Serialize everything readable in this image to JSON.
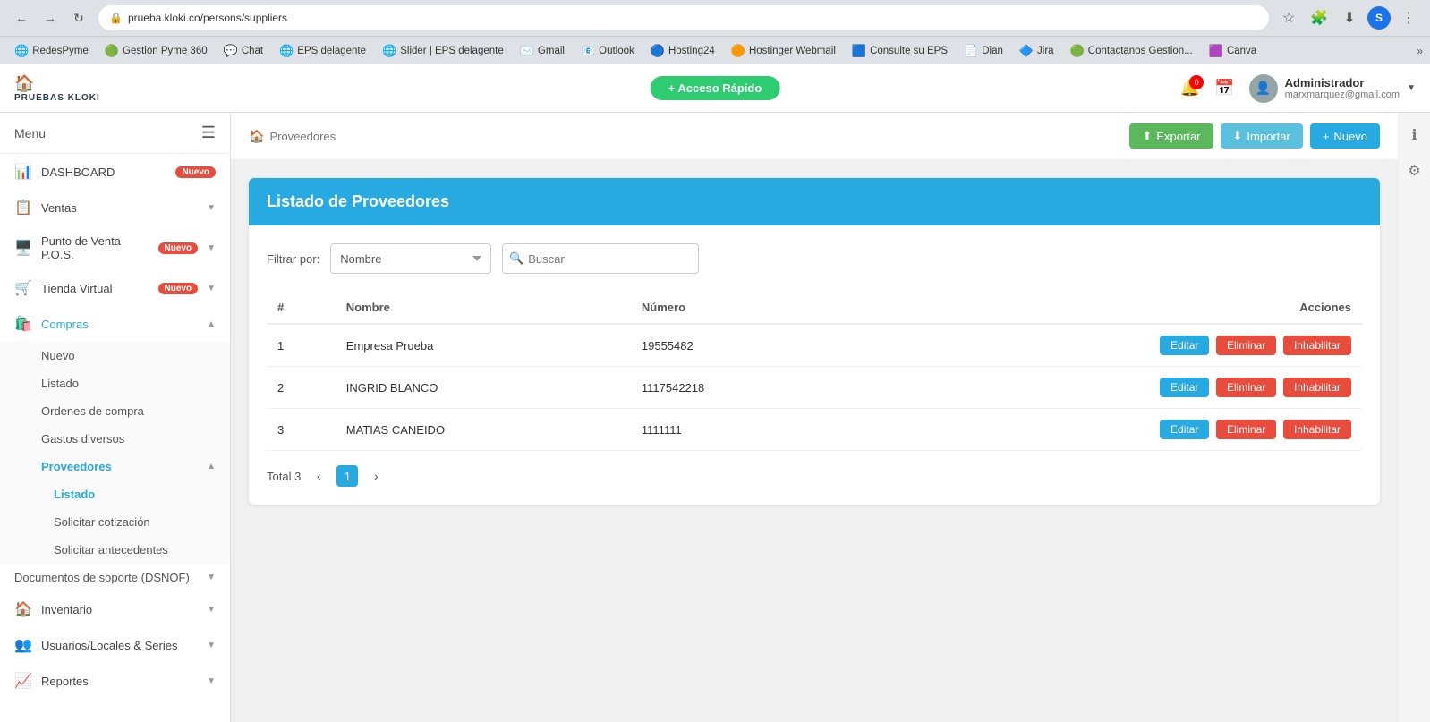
{
  "browser": {
    "url": "prueba.kloki.co/persons/suppliers",
    "user_initial": "S"
  },
  "bookmarks": [
    {
      "id": "redesPyme",
      "label": "RedesPyme",
      "icon": "🌐"
    },
    {
      "id": "gestionPyme",
      "label": "Gestion Pyme 360",
      "icon": "🟢"
    },
    {
      "id": "chat",
      "label": "Chat",
      "icon": "💬"
    },
    {
      "id": "epsDelagente",
      "label": "EPS delagente",
      "icon": "🌐"
    },
    {
      "id": "slider",
      "label": "Slider | EPS delagente",
      "icon": "🌐"
    },
    {
      "id": "gmail",
      "label": "Gmail",
      "icon": "✉️"
    },
    {
      "id": "outlook",
      "label": "Outlook",
      "icon": "📧"
    },
    {
      "id": "hosting24",
      "label": "Hosting24",
      "icon": "🔵"
    },
    {
      "id": "hostingerWebmail",
      "label": "Hostinger Webmail",
      "icon": "🟠"
    },
    {
      "id": "consulteSuEps",
      "label": "Consulte su EPS",
      "icon": "🟦"
    },
    {
      "id": "dian",
      "label": "Dian",
      "icon": "📄"
    },
    {
      "id": "jira",
      "label": "Jira",
      "icon": "🔷"
    },
    {
      "id": "contactanos",
      "label": "Contactanos Gestion...",
      "icon": "🟢"
    },
    {
      "id": "canva",
      "label": "Canva",
      "icon": "🟪"
    }
  ],
  "header": {
    "logo_text": "PRUEBAS KLOKI",
    "quick_access_label": "+ Acceso Rápido",
    "notification_count": "0",
    "user_name": "Administrador",
    "user_email": "marxmarquez@gmail.com"
  },
  "sidebar": {
    "menu_label": "Menu",
    "items": [
      {
        "id": "dashboard",
        "label": "DASHBOARD",
        "icon": "📊",
        "badge": "Nuevo",
        "has_arrow": false
      },
      {
        "id": "ventas",
        "label": "Ventas",
        "icon": "📋",
        "has_arrow": true
      },
      {
        "id": "puntoVenta",
        "label": "Punto de Venta P.O.S.",
        "icon": "🖥️",
        "badge": "Nuevo",
        "has_arrow": true
      },
      {
        "id": "tiendaVirtual",
        "label": "Tienda Virtual",
        "icon": "🛒",
        "badge": "Nuevo",
        "has_arrow": true
      },
      {
        "id": "compras",
        "label": "Compras",
        "icon": "🛍️",
        "active": true,
        "has_arrow": true
      }
    ],
    "compras_submenu": [
      {
        "id": "nuevo",
        "label": "Nuevo"
      },
      {
        "id": "listado",
        "label": "Listado"
      },
      {
        "id": "ordenes",
        "label": "Ordenes de compra"
      },
      {
        "id": "gastos",
        "label": "Gastos diversos"
      },
      {
        "id": "proveedores",
        "label": "Proveedores",
        "active": true,
        "has_arrow": true
      }
    ],
    "proveedores_submenu": [
      {
        "id": "listado",
        "label": "Listado",
        "active": true
      },
      {
        "id": "solicitar_cotizacion",
        "label": "Solicitar cotización"
      },
      {
        "id": "solicitar_antecedentes",
        "label": "Solicitar antecedentes"
      }
    ],
    "bottom_items": [
      {
        "id": "documentos",
        "label": "Documentos de soporte (DSNOF)",
        "has_arrow": true
      },
      {
        "id": "inventario",
        "label": "Inventario",
        "icon": "🏠",
        "has_arrow": true
      },
      {
        "id": "usuarios",
        "label": "Usuarios/Locales & Series",
        "icon": "👥",
        "has_arrow": true
      },
      {
        "id": "reportes",
        "label": "Reportes",
        "icon": "📈",
        "has_arrow": true
      }
    ]
  },
  "page": {
    "breadcrumb_icon": "🏠",
    "breadcrumb_label": "Proveedores",
    "export_label": "Exportar",
    "import_label": "Importar",
    "nuevo_label": "Nuevo",
    "card_title": "Listado de Proveedores",
    "filter_label": "Filtrar por:",
    "filter_options": [
      "Nombre"
    ],
    "filter_selected": "Nombre",
    "search_placeholder": "Buscar",
    "table": {
      "columns": [
        "#",
        "Nombre",
        "Número",
        "Acciones"
      ],
      "rows": [
        {
          "num": "1",
          "name": "Empresa Prueba",
          "numero": "19555482"
        },
        {
          "num": "2",
          "name": "INGRID BLANCO",
          "numero": "1117542218"
        },
        {
          "num": "3",
          "name": "MATIAS CANEIDO",
          "numero": "1111111"
        }
      ]
    },
    "row_actions": {
      "edit": "Editar",
      "delete": "Eliminar",
      "disable": "Inhabilitar"
    },
    "pagination": {
      "total_label": "Total 3",
      "current_page": "1"
    }
  }
}
